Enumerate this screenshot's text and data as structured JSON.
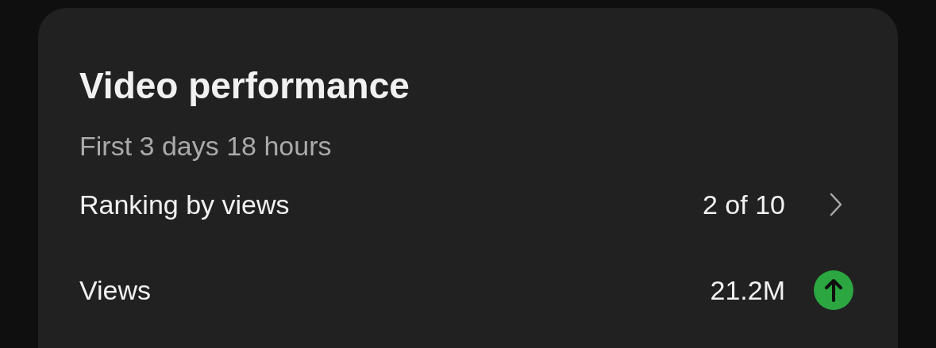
{
  "card": {
    "title": "Video performance",
    "subtitle": "First 3 days 18 hours",
    "rows": [
      {
        "label": "Ranking by views",
        "value": "2 of 10",
        "kind": "link"
      },
      {
        "label": "Views",
        "value": "21.2M",
        "kind": "trend"
      }
    ]
  }
}
